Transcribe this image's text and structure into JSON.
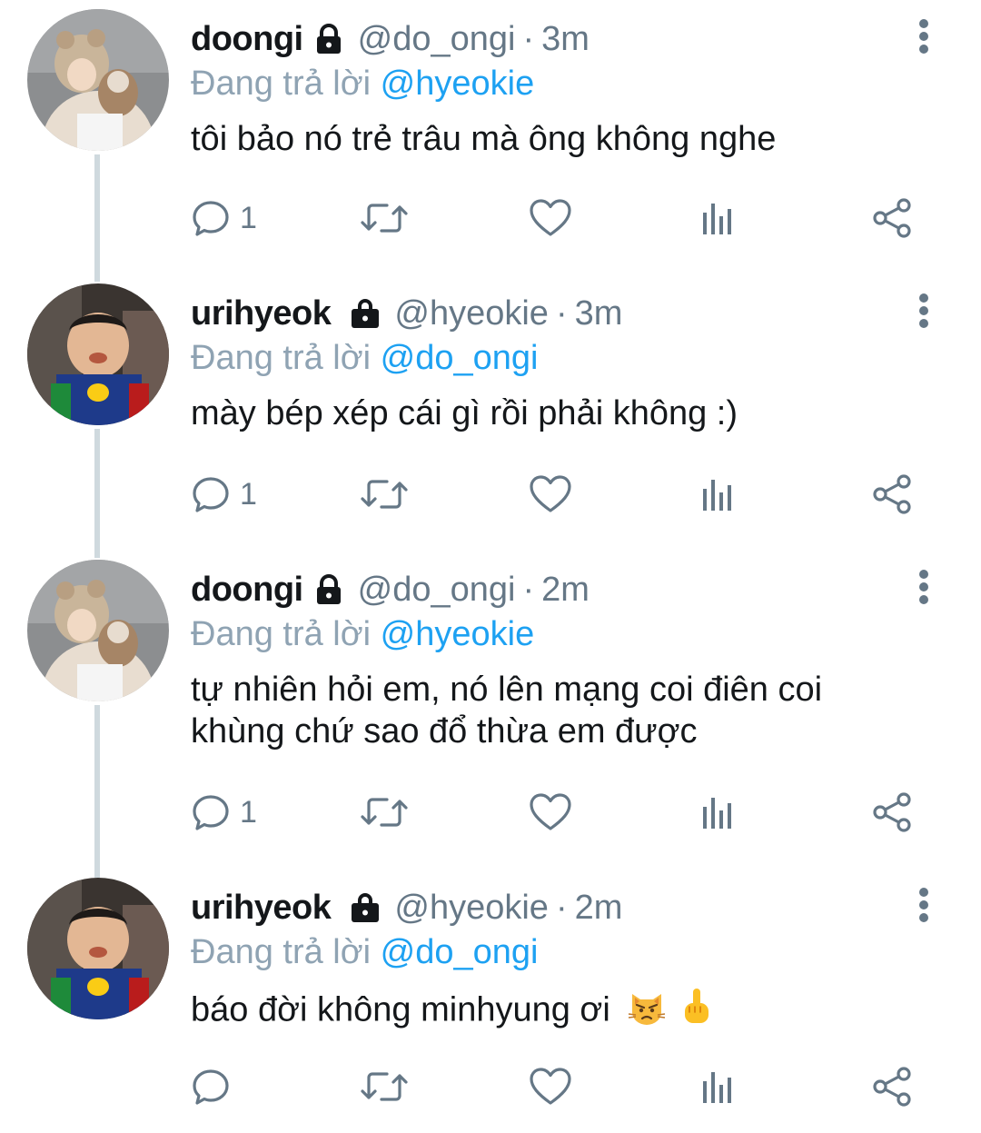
{
  "reply_prefix": "Đang trả lời",
  "tweets": [
    {
      "display_name": "doongi",
      "handle": "@do_ongi",
      "separator": "·",
      "time": "3m",
      "reply_to": "@hyeokie",
      "text": "tôi bảo nó trẻ trâu mà ông không nghe",
      "reply_count": "1"
    },
    {
      "display_name": "urihyeok",
      "handle": "@hyeokie",
      "separator": "·",
      "time": "3m",
      "reply_to": "@do_ongi",
      "text": "mày bép xép cái gì rồi phải không :)",
      "reply_count": "1"
    },
    {
      "display_name": "doongi",
      "handle": "@do_ongi",
      "separator": "·",
      "time": "2m",
      "reply_to": "@hyeokie",
      "text": "tự nhiên hỏi em, nó lên mạng coi điên coi khùng chứ sao đổ thừa em được",
      "reply_count": "1"
    },
    {
      "display_name": "urihyeok",
      "handle": "@hyeokie",
      "separator": "·",
      "time": "2m",
      "reply_to": "@do_ongi",
      "text": "báo đời không minhyung ơi",
      "reply_count": ""
    }
  ],
  "icons": {
    "reply": "reply-icon",
    "retweet": "retweet-icon",
    "like": "heart-icon",
    "stats": "stats-icon",
    "share": "share-icon",
    "more": "more-vertical-icon",
    "lock": "lock-icon",
    "emoji_1": "pouting-cat-emoji",
    "emoji_2": "hand-gesture-emoji"
  },
  "colors": {
    "primary_text": "#14171a",
    "secondary_text": "#657786",
    "link": "#1da1f2",
    "thread_line": "#cfd9de"
  }
}
